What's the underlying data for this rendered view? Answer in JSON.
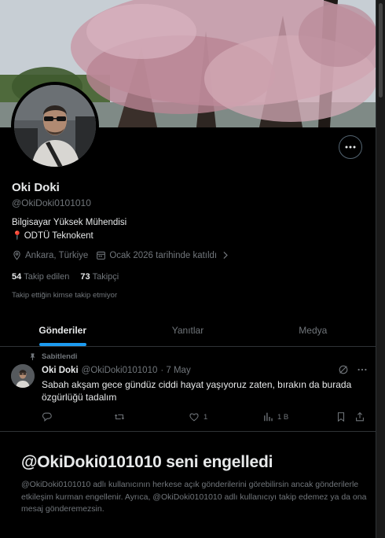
{
  "profile": {
    "name": "Oki Doki",
    "handle": "@OkiDoki0101010",
    "bio_line1": "Bilgisayar Yüksek Mühendisi",
    "bio_line2": "ODTÜ Teknokent",
    "location": "Ankara, Türkiye",
    "joined": "Ocak 2026 tarihinde katıldı",
    "following_count": "54",
    "following_label": "Takip edilen",
    "followers_count": "73",
    "followers_label": "Takipçi",
    "no_mutuals": "Takip ettiğin kimse takip etmiyor"
  },
  "tabs": [
    {
      "label": "Gönderiler",
      "active": true
    },
    {
      "label": "Yanıtlar",
      "active": false
    },
    {
      "label": "Medya",
      "active": false
    }
  ],
  "tweet": {
    "pinned_label": "Sabitlendi",
    "author": "Oki Doki",
    "handle": "@OkiDoki0101010",
    "date": "· 7 May",
    "text": "Sabah akşam gece gündüz ciddi hayat yaşıyoruz zaten, bırakın da burada özgürlüğü tadalım",
    "likes": "1",
    "views": "1 B"
  },
  "blocked": {
    "title": "@OkiDoki0101010 seni engelledi",
    "description": "@OkiDoki0101010 adlı kullanıcının herkese açık gönderilerini görebilirsin ancak gönderilerle etkileşim kurman engellenir. Ayrıca, @OkiDoki0101010 adlı kullanıcıyı takip edemez ya da ona mesaj gönderemezsin."
  },
  "colors": {
    "accent": "#1d9bf0",
    "background": "#000000",
    "text": "#e7e9ea",
    "muted": "#71767b"
  }
}
